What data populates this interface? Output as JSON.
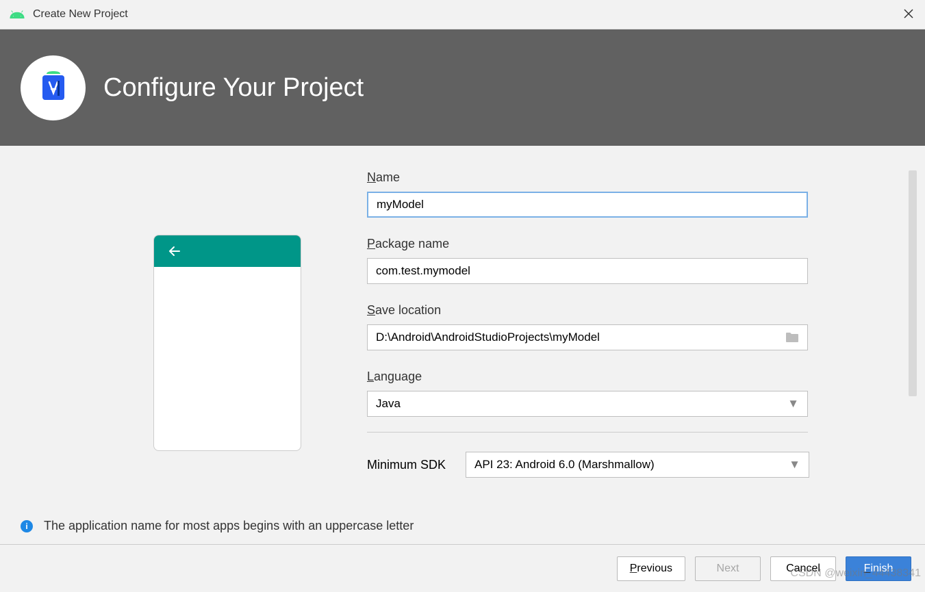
{
  "window": {
    "title": "Create New Project"
  },
  "header": {
    "title": "Configure Your Project"
  },
  "form": {
    "name": {
      "label": "Name",
      "value": "myModel"
    },
    "package": {
      "label": "Package name",
      "value": "com.test.mymodel"
    },
    "save": {
      "label": "Save location",
      "value": "D:\\Android\\AndroidStudioProjects\\myModel"
    },
    "language": {
      "label": "Language",
      "value": "Java"
    },
    "minsdk": {
      "label": "Minimum SDK",
      "value": "API 23: Android 6.0 (Marshmallow)"
    }
  },
  "hint": "The application name for most apps begins with an uppercase letter",
  "buttons": {
    "previous": "Previous",
    "next": "Next",
    "cancel": "Cancel",
    "finish": "Finish"
  },
  "watermark": "CSDN @weixin_44438341"
}
